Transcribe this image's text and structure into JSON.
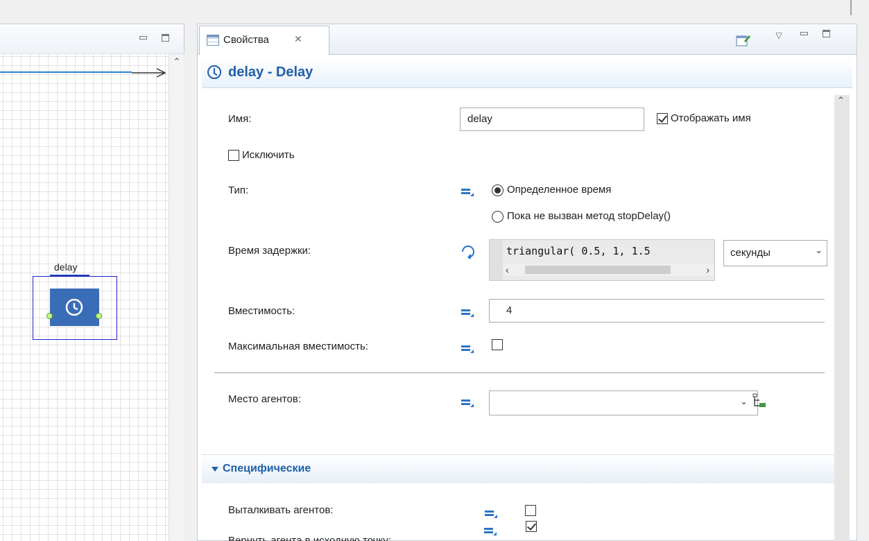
{
  "canvas": {
    "block_label": "delay"
  },
  "properties_view": {
    "tab_label": "Свойства",
    "title": "delay - Delay",
    "fields": {
      "name_label": "Имя:",
      "name_value": "delay",
      "show_name_label": "Отображать имя",
      "show_name_checked": true,
      "exclude_label": "Исключить",
      "exclude_checked": false,
      "type_label": "Тип:",
      "type_options": [
        "Определенное время",
        "Пока не вызван метод stopDelay()"
      ],
      "type_selected": "Определенное время",
      "delay_time_label": "Время задержки:",
      "delay_time_value": "triangular( 0.5, 1, 1.5",
      "delay_time_unit": "секунды",
      "capacity_label": "Вместимость:",
      "capacity_value": "4",
      "max_capacity_label": "Максимальная вместимость:",
      "max_capacity_checked": false,
      "agent_location_label": "Место агентов:",
      "agent_location_value": ""
    },
    "section_specific": {
      "title": "Специфические",
      "expanded": true,
      "push_agents_label": "Выталкивать агентов:",
      "push_agents_checked": false,
      "return_agent_label": "Вернуть агента в исходную точку:",
      "return_agent_checked": true
    }
  },
  "colors": {
    "accent": "#1f5fa8",
    "block_fill": "#3a6db8",
    "selection": "#2020cc",
    "port": "#c8f58c"
  }
}
